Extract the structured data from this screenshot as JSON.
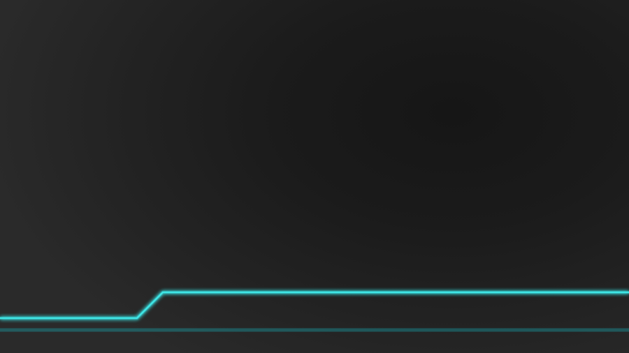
{
  "background": {
    "base_color": "#1c1c1c",
    "center_color": "#161616",
    "edge_color": "#2a2a2a"
  },
  "neon_lines": {
    "color": "#3fe6e6",
    "glow_color": "#17b8c0",
    "line_count": 2
  }
}
